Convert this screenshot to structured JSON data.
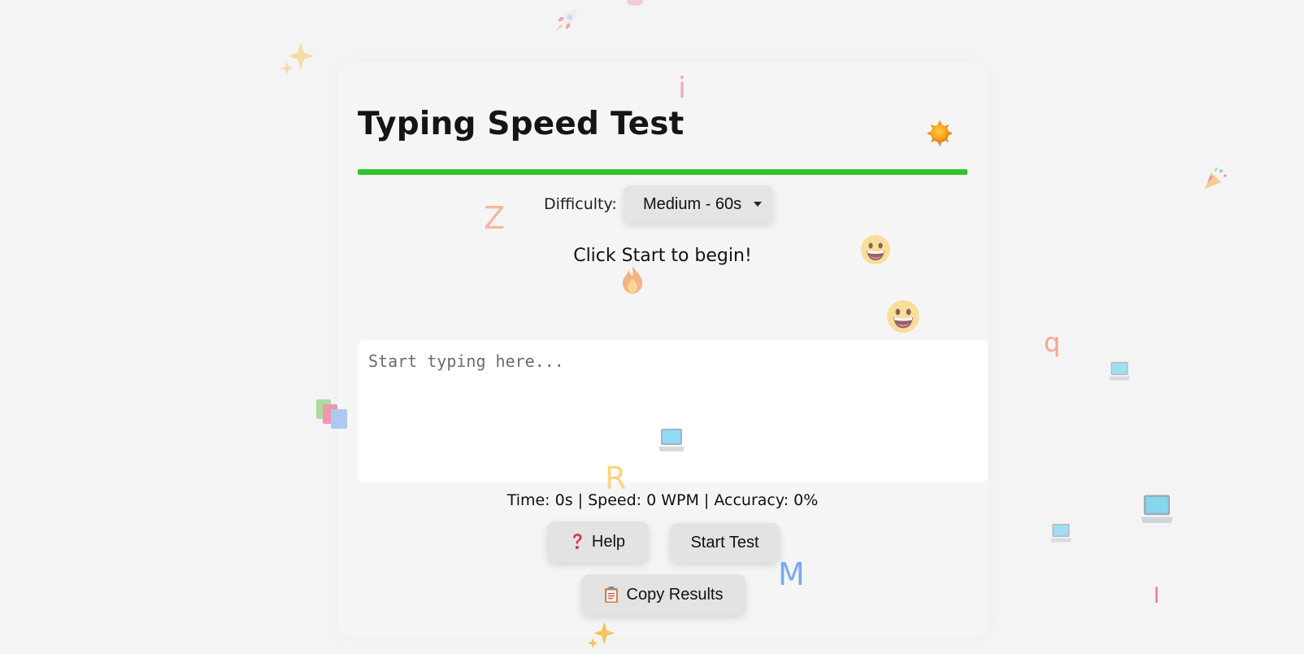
{
  "app": {
    "title": "Typing Speed Test"
  },
  "progress": {
    "fraction": 1.0,
    "color": "#2fc52f"
  },
  "difficulty": {
    "label": "Difficulty:",
    "selected": "Medium - 60s"
  },
  "status": {
    "message": "Click Start to begin!"
  },
  "typing_area": {
    "value": "",
    "placeholder": "Start typing here..."
  },
  "stats": {
    "text": "Time: 0s | Speed: 0 WPM | Accuracy: 0%"
  },
  "buttons": {
    "help_label": "Help",
    "start_label": "Start Test",
    "copy_label": "Copy Results"
  },
  "icons": {
    "theme_toggle": "sun-icon",
    "help": "question-mark-icon",
    "copy": "clipboard-icon"
  },
  "floating_letters": [
    "i",
    "Z",
    "q",
    "R",
    "M",
    "l"
  ],
  "colors": {
    "background": "#f4f4f4",
    "button": "#e3e3e3",
    "accent": "#2fc52f"
  }
}
